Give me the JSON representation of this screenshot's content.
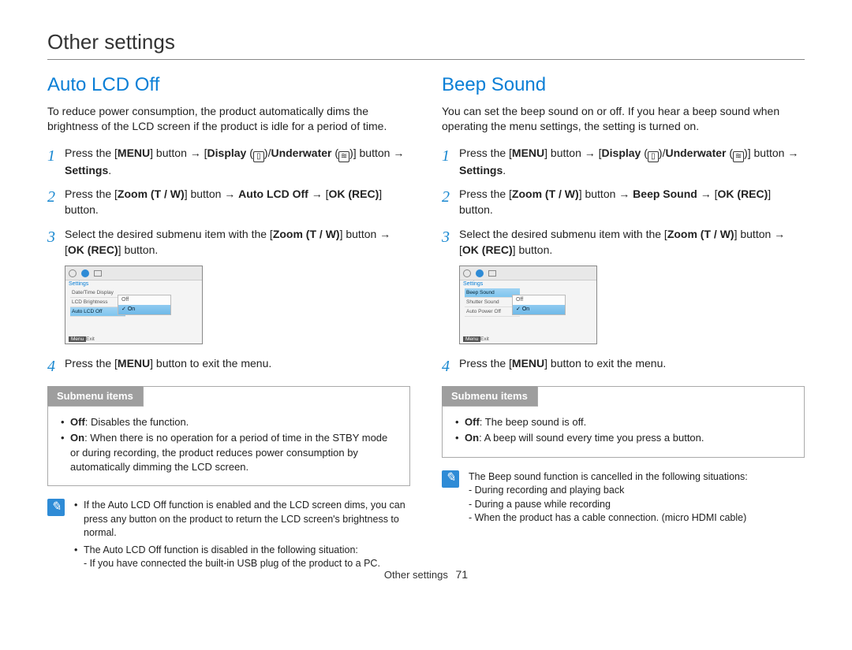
{
  "page": {
    "title": "Other settings",
    "footer_label": "Other settings",
    "page_number": "71"
  },
  "left": {
    "title": "Auto LCD Off",
    "intro": "To reduce power consumption, the product automatically dims the brightness of the LCD screen if the product is idle for a period of time.",
    "steps": {
      "s1_a": "Press the [",
      "s1_menu": "MENU",
      "s1_b": "] button ",
      "s1_arrow": "→",
      "s1_c": " [",
      "s1_display": "Display",
      "s1_d": " (",
      "s1_e": ")/",
      "s1_under": "Underwater",
      "s1_f": " (",
      "s1_g": ")] button ",
      "s1_h": " ",
      "s1_settings": "Settings",
      "s1_i": ".",
      "s2_a": "Press the [",
      "s2_zoom": "Zoom",
      "s2_tw": " (T / W)",
      "s2_b": "] button ",
      "s2_item": "Auto LCD Off",
      "s2_c": " [",
      "s2_okrec": "OK (REC)",
      "s2_d": "] button.",
      "s3_a": "Select the desired submenu item with the [",
      "s3_b": "] button ",
      "s3_c": " [",
      "s3_d": "] button.",
      "s4": "Press the [",
      "s4_menu": "MENU",
      "s4_b": "] button to exit the menu."
    },
    "screenshot": {
      "settings_label": "Settings",
      "row1": "Date/Time Display",
      "row2": "LCD Brightness",
      "row3": "Auto LCD Off",
      "pop_off": "Off",
      "pop_on": "On",
      "exit_btn": "Menu",
      "exit_label": "Exit"
    },
    "submenu": {
      "tab": "Submenu items",
      "off_label": "Off",
      "off_text": ": Disables the function.",
      "on_label": "On",
      "on_text": ": When there is no operation for a period of time in the STBY mode or during recording, the product reduces power consumption by automatically dimming the LCD screen."
    },
    "note": {
      "b1_a": "If the Auto LCD Off function is enabled and the LCD screen dims, you can press any button on the product to return the LCD screen's brightness to normal.",
      "b2_a": "The Auto LCD Off function is disabled in the following situation:",
      "b2_sub": "- If you have connected the built-in USB plug of the product to a PC."
    }
  },
  "right": {
    "title": "Beep Sound",
    "intro": "You can set the beep sound on or off. If you hear a beep sound when operating the menu settings, the setting is turned on.",
    "steps": {
      "s2_item": "Beep Sound"
    },
    "screenshot": {
      "settings_label": "Settings",
      "row1": "Beep Sound",
      "row2": "Shutter Sound",
      "row3": "Auto Power Off",
      "pop_off": "Off",
      "pop_on": "On",
      "exit_btn": "Menu",
      "exit_label": "Exit"
    },
    "submenu": {
      "tab": "Submenu items",
      "off_label": "Off",
      "off_text": ": The beep sound is off.",
      "on_label": "On",
      "on_text": ": A beep will sound every time you press a button."
    },
    "note": {
      "intro": "The Beep sound function is cancelled in the following situations:",
      "l1": "- During recording and playing back",
      "l2": "- During a pause while recording",
      "l3": "- When the product has a cable connection. (micro HDMI cable)"
    }
  }
}
